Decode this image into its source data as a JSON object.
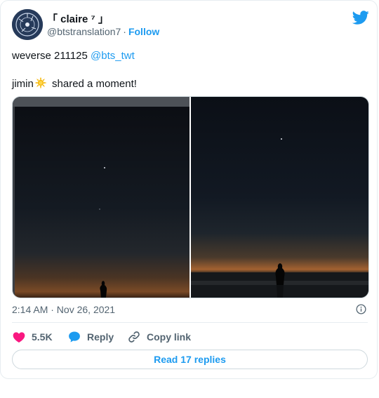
{
  "tweet": {
    "author_name": "「 claire ⁷ 」",
    "author_handle": "@btstranslation7",
    "separator": "·",
    "follow_label": "Follow",
    "line1_text": "weverse 211125 ",
    "line1_mention": "@bts_twt",
    "line2_prefix": "jimin",
    "line2_suffix": " shared a moment!",
    "timestamp": "2:14 AM · Nov 26, 2021"
  },
  "actions": {
    "like_count": "5.5K",
    "reply_label": "Reply",
    "copy_label": "Copy link",
    "read_replies_label": "Read 17 replies"
  },
  "colors": {
    "accent": "#1d9bf0",
    "like": "#f91880",
    "secondary_text": "#536471"
  },
  "icons": [
    "avatar",
    "twitter-bird-icon",
    "sun-emoji-icon",
    "info-icon",
    "heart-icon",
    "reply-bubble-icon",
    "link-icon"
  ]
}
